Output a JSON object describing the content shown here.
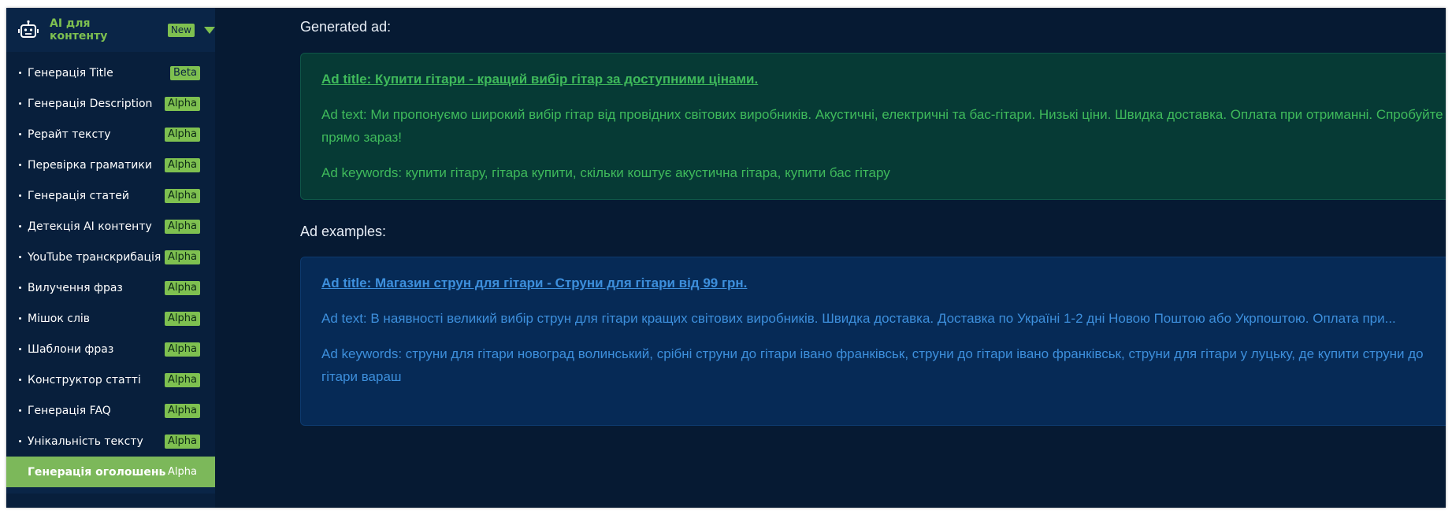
{
  "sidebar": {
    "icon": "robot-icon",
    "title": "AI для контенту",
    "badge": "New",
    "items": [
      {
        "label": "Генерація Title",
        "badge": "Beta"
      },
      {
        "label": "Генерація Description",
        "badge": "Alpha"
      },
      {
        "label": "Рерайт тексту",
        "badge": "Alpha"
      },
      {
        "label": "Перевірка граматики",
        "badge": "Alpha"
      },
      {
        "label": "Генерація статей",
        "badge": "Alpha"
      },
      {
        "label": "Детекція AI контенту",
        "badge": "Alpha"
      },
      {
        "label": "YouTube транскрибація",
        "badge": "Alpha"
      },
      {
        "label": "Вилучення фраз",
        "badge": "Alpha"
      },
      {
        "label": "Мішок слів",
        "badge": "Alpha"
      },
      {
        "label": "Шаблони фраз",
        "badge": "Alpha"
      },
      {
        "label": "Конструктор статті",
        "badge": "Alpha"
      },
      {
        "label": "Генерація FAQ",
        "badge": "Alpha"
      },
      {
        "label": "Унікальність тексту",
        "badge": "Alpha"
      },
      {
        "label": "Генерація оголошень",
        "badge": "Alpha",
        "active": true
      }
    ]
  },
  "main": {
    "generated_label": "Generated ad:",
    "generated": {
      "title": "Ad title: Купити гітари - кращий вибір гітар за доступними цінами.",
      "text": "Ad text: Ми пропонуємо широкий вибір гітар від провідних світових виробників. Акустичні, електричні та бас-гітари. Низькі ціни. Швидка доставка. Оплата при отриманні. Спробуйте прямо зараз!",
      "keywords": "Ad keywords: купити гітару, гітара купити, скільки коштує акустична гітара, купити бас гітару"
    },
    "examples_label": "Ad examples:",
    "example": {
      "title": "Ad title: Магазин струн для гітари - Струни для гітари від 99 грн.",
      "text": "Ad text: В наявності великий вибір струн для гітари кращих світових виробників. Швидка доставка. Доставка по Україні 1-2 дні Новою Поштою або Укрпоштою. Оплата при...",
      "keywords": "Ad keywords: струни для гітари новоград волинський, срібні струни до гітари івано франківськ, струни до гітари івано франківськ, струни для гітари у луцьку, де купити струни до гітари вараш"
    }
  },
  "colors": {
    "accent_green": "#7ec050",
    "generated_text": "#3fba5b",
    "example_text": "#3d8fdc",
    "background": "#061a33"
  }
}
